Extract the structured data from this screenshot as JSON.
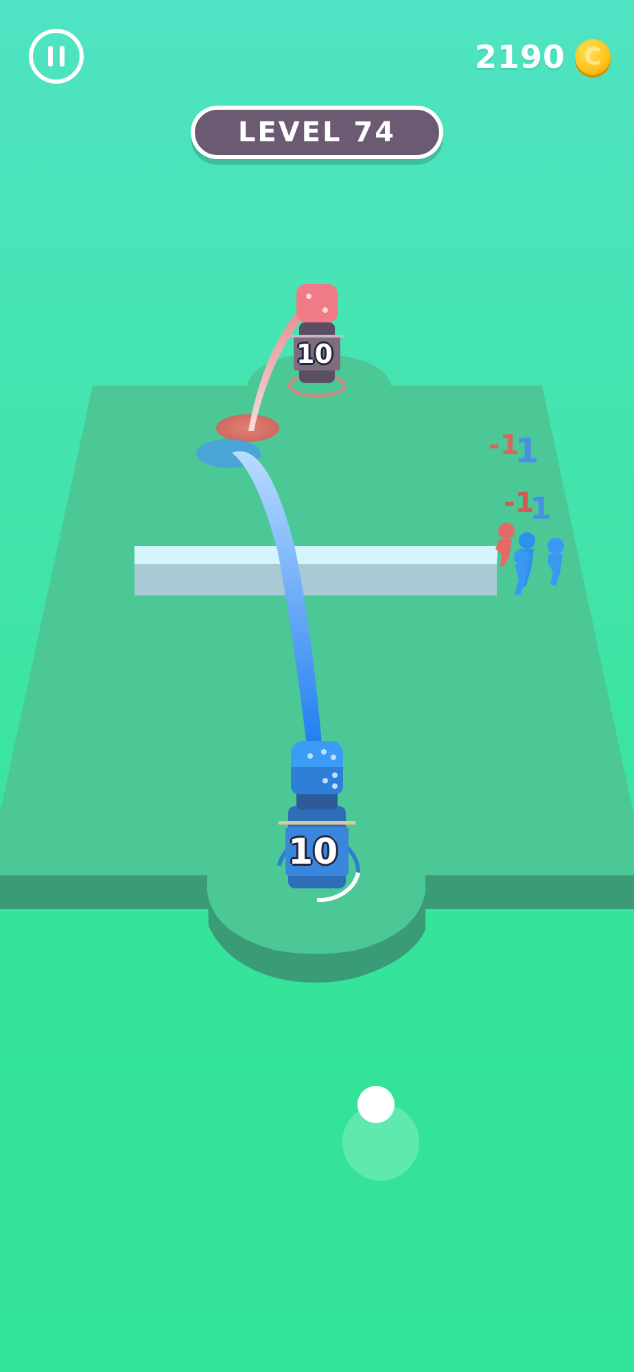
{
  "hud": {
    "pause_icon": "pause-icon",
    "coins": "2190",
    "coin_icon": "coin-icon",
    "coin_symbol": "C",
    "level_label": "LEVEL 74"
  },
  "enemy_tower": {
    "count": "10",
    "color": "#e8707a",
    "dice_icon": "dice-icon"
  },
  "player_tower": {
    "count": "10",
    "color": "#3b8ef0",
    "dice_icon": "dice-icon"
  },
  "floating_damage": [
    {
      "minus": "-1",
      "one": "1"
    },
    {
      "minus": "-1",
      "one": "1"
    }
  ],
  "colors": {
    "background": "#3fe4a6",
    "board": "#4cc796",
    "board_side": "#3a9c76",
    "wall": "#cbeef5",
    "enemy": "#e8707a",
    "player": "#3b8ef0",
    "level_pill": "#6b5a72",
    "coin": "#ffc21a"
  },
  "control": {
    "joystick_icon": "joystick-icon"
  }
}
